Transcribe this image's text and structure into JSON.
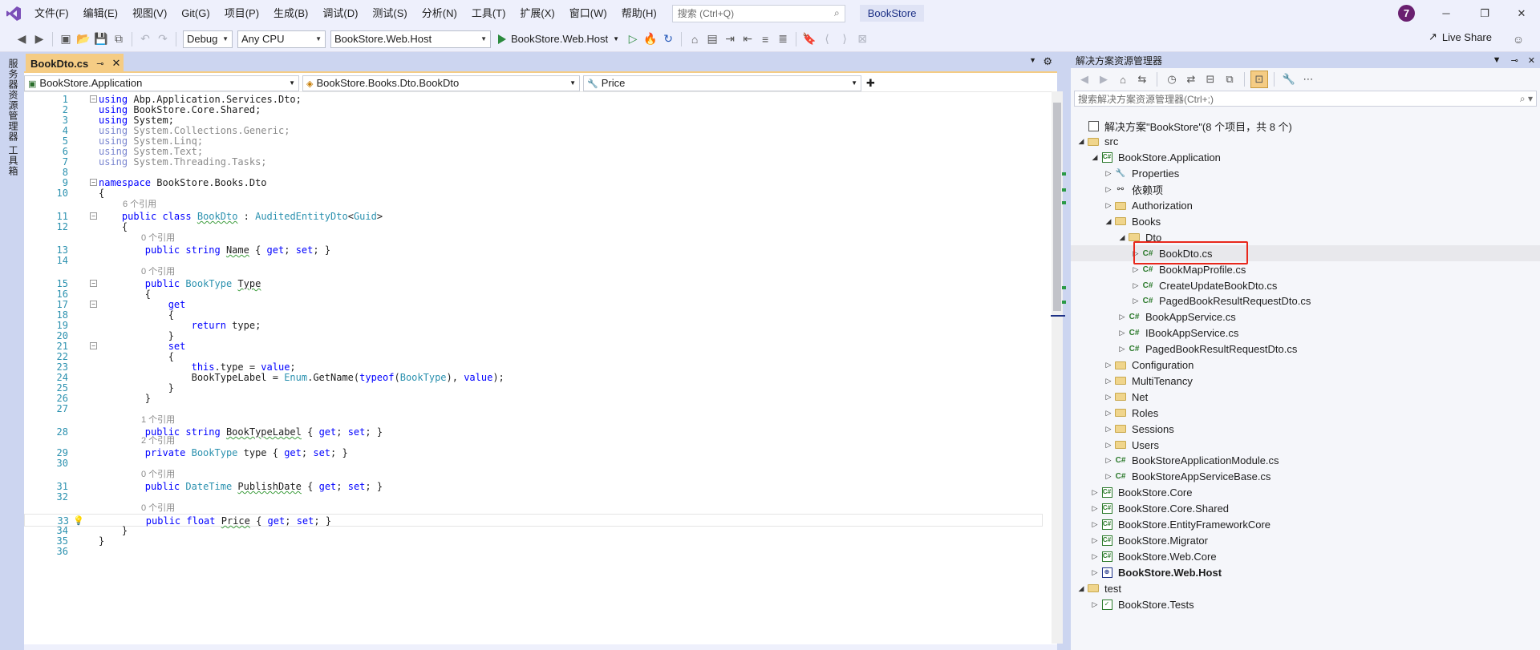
{
  "menu": {
    "items": [
      "文件(F)",
      "编辑(E)",
      "视图(V)",
      "Git(G)",
      "项目(P)",
      "生成(B)",
      "调试(D)",
      "测试(S)",
      "分析(N)",
      "工具(T)",
      "扩展(X)",
      "窗口(W)",
      "帮助(H)"
    ],
    "search_placeholder": "搜索 (Ctrl+Q)",
    "solution_name": "BookStore",
    "avatar_letter": "7"
  },
  "toolbar": {
    "config": "Debug",
    "platform": "Any CPU",
    "startup_project": "BookStore.Web.Host",
    "run_label": "BookStore.Web.Host",
    "live_share": "Live Share"
  },
  "left_strip": {
    "tab1": "服务器资源管理器",
    "tab2": "工具箱"
  },
  "editor": {
    "tab_title": "BookDto.cs",
    "nav_project": "BookStore.Application",
    "nav_type": "BookStore.Books.Dto.BookDto",
    "nav_member": "Price",
    "lines": [
      {
        "n": "1",
        "t": "using Abp.Application.Services.Dto;"
      },
      {
        "n": "2",
        "t": "using BookStore.Core.Shared;"
      },
      {
        "n": "3",
        "t": "using System;"
      },
      {
        "n": "4",
        "t": "using System.Collections.Generic;"
      },
      {
        "n": "5",
        "t": "using System.Linq;"
      },
      {
        "n": "6",
        "t": "using System.Text;"
      },
      {
        "n": "7",
        "t": "using System.Threading.Tasks;"
      },
      {
        "n": "8",
        "t": ""
      },
      {
        "n": "9",
        "t": "namespace BookStore.Books.Dto"
      },
      {
        "n": "10",
        "t": "{"
      },
      {
        "n": "11",
        "t": "    public class BookDto : AuditedEntityDto<Guid>"
      },
      {
        "n": "12",
        "t": "    {"
      },
      {
        "n": "13",
        "t": "        public string Name { get; set; }"
      },
      {
        "n": "14",
        "t": ""
      },
      {
        "n": "15",
        "t": "        public BookType Type"
      },
      {
        "n": "16",
        "t": "        {"
      },
      {
        "n": "17",
        "t": "            get"
      },
      {
        "n": "18",
        "t": "            {"
      },
      {
        "n": "19",
        "t": "                return type;"
      },
      {
        "n": "20",
        "t": "            }"
      },
      {
        "n": "21",
        "t": "            set"
      },
      {
        "n": "22",
        "t": "            {"
      },
      {
        "n": "23",
        "t": "                this.type = value;"
      },
      {
        "n": "24",
        "t": "                BookTypeLabel = Enum.GetName(typeof(BookType), value);"
      },
      {
        "n": "25",
        "t": "            }"
      },
      {
        "n": "26",
        "t": "        }"
      },
      {
        "n": "27",
        "t": ""
      },
      {
        "n": "28",
        "t": "        public string BookTypeLabel { get; set; }"
      },
      {
        "n": "29",
        "t": "        private BookType type { get; set; }"
      },
      {
        "n": "30",
        "t": ""
      },
      {
        "n": "31",
        "t": "        public DateTime PublishDate { get; set; }"
      },
      {
        "n": "32",
        "t": ""
      },
      {
        "n": "33",
        "t": "        public float Price { get; set; }"
      },
      {
        "n": "34",
        "t": "    }"
      },
      {
        "n": "35",
        "t": "}"
      },
      {
        "n": "36",
        "t": ""
      }
    ],
    "refs": {
      "r11": "6 个引用",
      "r13": "0 个引用",
      "r15": "0 个引用",
      "r28": "1 个引用",
      "r29": "2 个引用",
      "r31": "0 个引用",
      "r33": "0 个引用"
    }
  },
  "explorer": {
    "title": "解决方案资源管理器",
    "search_placeholder": "搜索解决方案资源管理器(Ctrl+;)",
    "nodes": [
      {
        "label": "解决方案\"BookStore\"(8 个项目，共 8 个)",
        "icon": "solution-icon"
      },
      {
        "label": "src",
        "icon": "folder-icon"
      },
      {
        "label": "BookStore.Application",
        "icon": "csharp-project-icon"
      },
      {
        "label": "Properties",
        "icon": "properties-icon"
      },
      {
        "label": "依赖项",
        "icon": "dependencies-icon"
      },
      {
        "label": "Authorization",
        "icon": "folder-icon"
      },
      {
        "label": "Books",
        "icon": "folder-icon"
      },
      {
        "label": "Dto",
        "icon": "folder-icon"
      },
      {
        "label": "BookDto.cs",
        "icon": "csharp-file-icon"
      },
      {
        "label": "BookMapProfile.cs",
        "icon": "csharp-file-icon"
      },
      {
        "label": "CreateUpdateBookDto.cs",
        "icon": "csharp-file-icon"
      },
      {
        "label": "PagedBookResultRequestDto.cs",
        "icon": "csharp-file-icon"
      },
      {
        "label": "BookAppService.cs",
        "icon": "csharp-file-icon"
      },
      {
        "label": "IBookAppService.cs",
        "icon": "csharp-file-icon"
      },
      {
        "label": "PagedBookResultRequestDto.cs",
        "icon": "csharp-file-icon"
      },
      {
        "label": "Configuration",
        "icon": "folder-icon"
      },
      {
        "label": "MultiTenancy",
        "icon": "folder-icon"
      },
      {
        "label": "Net",
        "icon": "folder-icon"
      },
      {
        "label": "Roles",
        "icon": "folder-icon"
      },
      {
        "label": "Sessions",
        "icon": "folder-icon"
      },
      {
        "label": "Users",
        "icon": "folder-icon"
      },
      {
        "label": "BookStoreApplicationModule.cs",
        "icon": "csharp-file-icon"
      },
      {
        "label": "BookStoreAppServiceBase.cs",
        "icon": "csharp-file-icon"
      },
      {
        "label": "BookStore.Core",
        "icon": "csharp-project-icon"
      },
      {
        "label": "BookStore.Core.Shared",
        "icon": "csharp-project-icon"
      },
      {
        "label": "BookStore.EntityFrameworkCore",
        "icon": "csharp-project-icon"
      },
      {
        "label": "BookStore.Migrator",
        "icon": "csharp-project-icon"
      },
      {
        "label": "BookStore.Web.Core",
        "icon": "csharp-project-icon"
      },
      {
        "label": "BookStore.Web.Host",
        "icon": "web-project-icon"
      },
      {
        "label": "test",
        "icon": "folder-icon"
      },
      {
        "label": "BookStore.Tests",
        "icon": "test-project-icon"
      }
    ]
  },
  "colors": {
    "accent": "#f5cc84",
    "keyword": "#0000ff",
    "type": "#2b91af",
    "selection_box": "#e8281c"
  }
}
